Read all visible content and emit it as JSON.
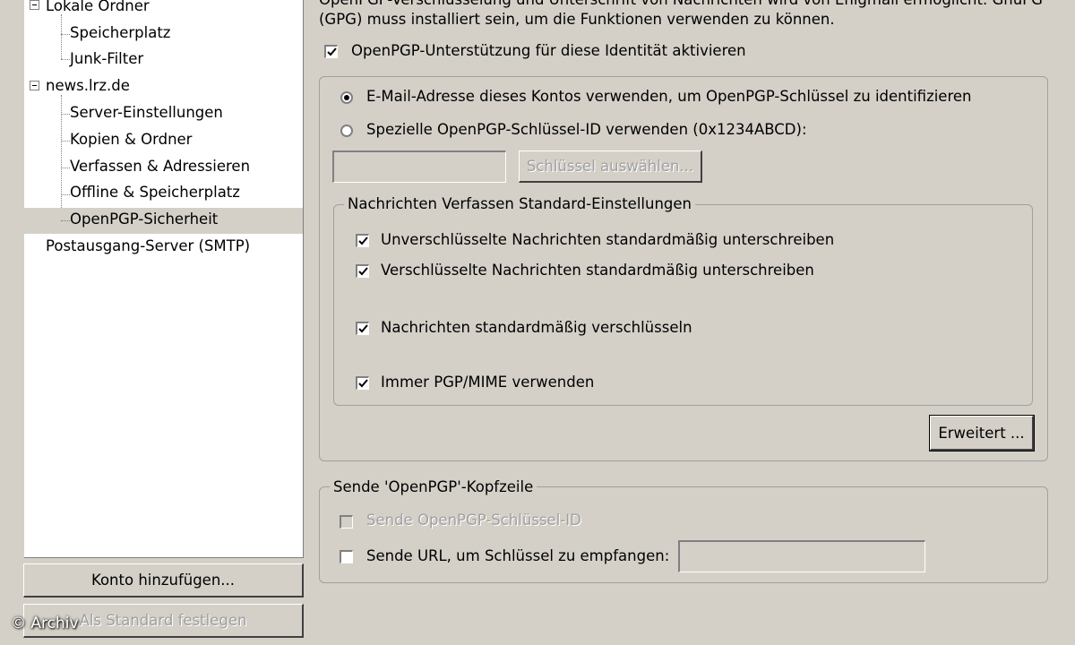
{
  "tree": {
    "items": [
      {
        "label": "Lokale Ordner"
      },
      {
        "label": "Speicherplatz"
      },
      {
        "label": "Junk-Filter"
      },
      {
        "label": "news.lrz.de"
      },
      {
        "label": "Server-Einstellungen"
      },
      {
        "label": "Kopien & Ordner"
      },
      {
        "label": "Verfassen & Adressieren"
      },
      {
        "label": "Offline & Speicherplatz"
      },
      {
        "label": "OpenPGP-Sicherheit"
      },
      {
        "label": "Postausgang-Server (SMTP)"
      }
    ]
  },
  "buttons": {
    "add_account": "Konto hinzufügen...",
    "set_default": "Als Standard festlegen",
    "select_key": "Schlüssel auswählen...",
    "advanced": "Erweitert ..."
  },
  "intro": {
    "line1": "OpenPGP-Verschlüsselung und Unterschrift von Nachrichten wird von Enigmail ermöglicht. GnuPG",
    "line2": "(GPG) muss installiert sein, um die Funktionen verwenden zu können."
  },
  "enable_openpgp": {
    "label": "OpenPGP-Unterstützung für diese Identität aktivieren",
    "checked": true
  },
  "key_id": {
    "use_email": {
      "label": "E-Mail-Adresse dieses Kontos verwenden, um OpenPGP-Schlüssel zu identifizieren",
      "selected": true
    },
    "use_specific": {
      "label": "Spezielle OpenPGP-Schlüssel-ID verwenden (0x1234ABCD):",
      "selected": false
    },
    "key_value": ""
  },
  "compose_defaults": {
    "legend": "Nachrichten Verfassen Standard-Einstellungen",
    "options": [
      {
        "label": "Unverschlüsselte Nachrichten standardmäßig unterschreiben",
        "checked": true
      },
      {
        "label": "Verschlüsselte Nachrichten standardmäßig unterschreiben",
        "checked": true
      },
      {
        "label": "Nachrichten standardmäßig verschlüsseln",
        "checked": true
      },
      {
        "label": "Immer PGP/MIME verwenden",
        "checked": true
      }
    ]
  },
  "header_group": {
    "legend": "Sende 'OpenPGP'-Kopfzeile",
    "send_key_id": {
      "label": "Sende OpenPGP-Schlüssel-ID",
      "checked": false,
      "disabled": true
    },
    "send_url": {
      "label": "Sende URL, um Schlüssel zu empfangen:",
      "checked": false
    },
    "url_value": ""
  },
  "watermark": "© Archiv"
}
